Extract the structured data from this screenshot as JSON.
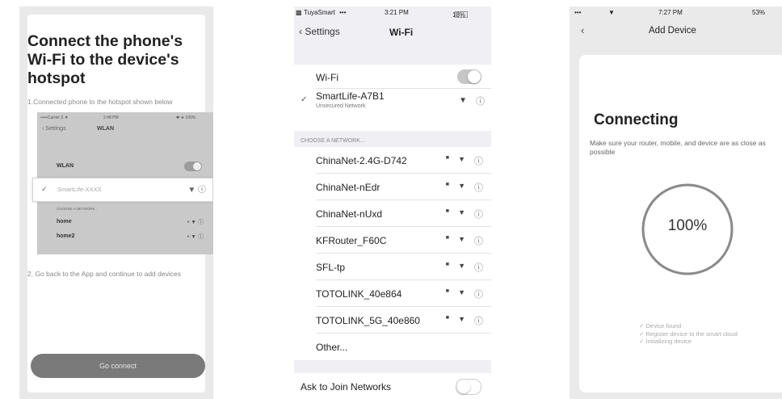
{
  "panel1": {
    "title": "Connect the phone's Wi-Fi to the device's hotspot",
    "step1": "1.Connected phone to the hotspot shown below",
    "mini": {
      "carrier": "•••••Carrier 3 ▼",
      "time": "2:48 PM",
      "battery": "✱ ★ 100%",
      "back": "Settings",
      "title": "WLAN",
      "wlan_label": "WLAN",
      "choose": "CHOOSE A NETWORK...",
      "networks": [
        {
          "name": "home",
          "icons": "• ▼ ⓘ"
        },
        {
          "name": "home2",
          "icons": "• ▼ ⓘ"
        }
      ]
    },
    "highlight": {
      "check": "✓",
      "ssid": "SmartLife-XXXX",
      "icons": "▼ ⓘ"
    },
    "step2": "2. Go back to the App and continue to add devices",
    "go_button": "Go connect"
  },
  "panel2": {
    "status": {
      "carrier": "TuyaSmart",
      "signal": "•••",
      "time": "3:21 PM",
      "battery": "18%"
    },
    "nav": {
      "back": "Settings",
      "title": "Wi-Fi"
    },
    "wifi_label": "Wi-Fi",
    "wifi_on": true,
    "connected": {
      "check": "✓",
      "ssid": "SmartLife-A7B1",
      "subtitle": "Unsecured Network"
    },
    "choose_header": "CHOOSE A NETWORK...",
    "networks": [
      {
        "name": "ChinaNet-2.4G-D742"
      },
      {
        "name": "ChinaNet-nEdr"
      },
      {
        "name": "ChinaNet-nUxd"
      },
      {
        "name": "KFRouter_F60C"
      },
      {
        "name": "SFL-tp"
      },
      {
        "name": "TOTOLINK_40e864"
      },
      {
        "name": "TOTOLINK_5G_40e860"
      }
    ],
    "other": "Other...",
    "ask_label": "Ask to Join Networks",
    "ask_on": false,
    "icons": {
      "lock": "lock-icon",
      "wifi": "wifi-icon",
      "info": "info-icon"
    }
  },
  "panel3": {
    "status": {
      "signal": "•••",
      "wifi": "▼",
      "time": "7:27 PM",
      "battery": "53%"
    },
    "nav": {
      "back": "‹",
      "title": "Add Device"
    },
    "heading": "Connecting",
    "description": "Make sure your router, mobile, and device are as close as possible",
    "progress_percent": 100,
    "progress_text": "100%",
    "steps": [
      "✓ Device found",
      "✓ Register device to the smart cloud",
      "✓ Initializing device"
    ],
    "ring_color": "#8a8a8a"
  }
}
